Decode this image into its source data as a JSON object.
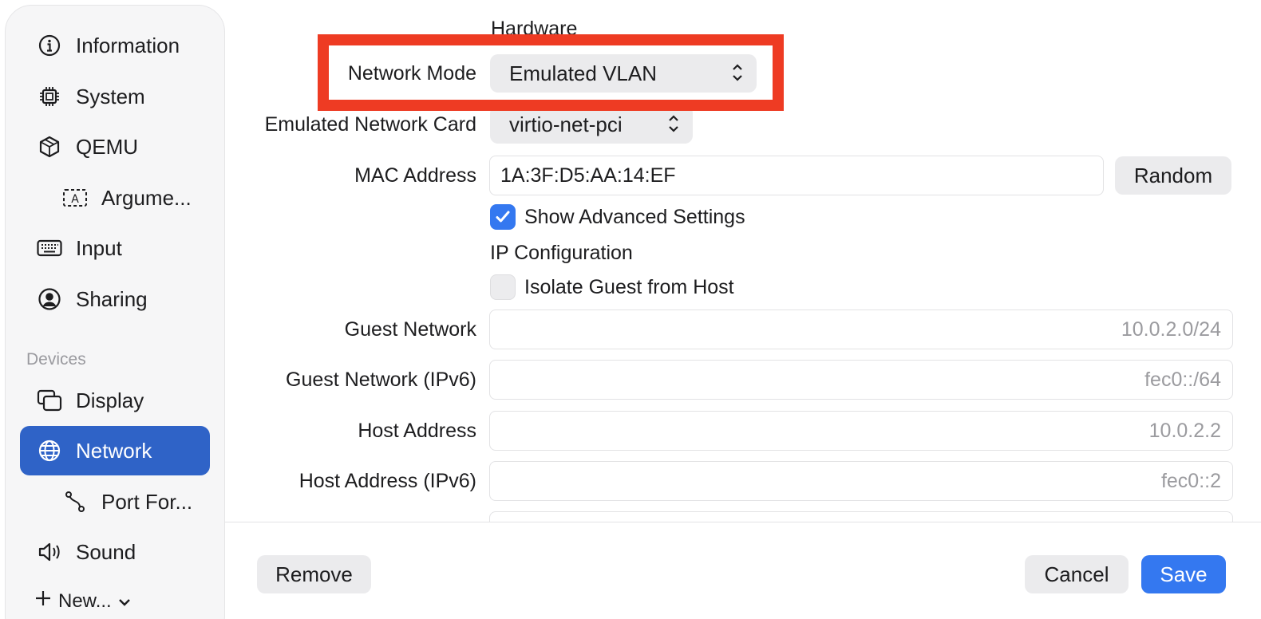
{
  "sidebar": {
    "items": [
      {
        "label": "Information",
        "icon": "info-circle-icon"
      },
      {
        "label": "System",
        "icon": "cpu-chip-icon"
      },
      {
        "label": "QEMU",
        "icon": "cube-icon"
      },
      {
        "label": "Argume...",
        "icon": "text-box-icon"
      },
      {
        "label": "Input",
        "icon": "keyboard-icon"
      },
      {
        "label": "Sharing",
        "icon": "person-circle-icon"
      },
      {
        "label": "Display",
        "icon": "display-windows-icon"
      },
      {
        "label": "Network",
        "icon": "globe-icon"
      },
      {
        "label": "Port For...",
        "icon": "route-icon"
      },
      {
        "label": "Sound",
        "icon": "speaker-icon"
      }
    ],
    "devices_header": "Devices",
    "new_label": "New...",
    "selected_item": "Network",
    "selected_color": "#2f63c7"
  },
  "form": {
    "hardware_title": "Hardware",
    "network_mode": {
      "label": "Network Mode",
      "value": "Emulated VLAN"
    },
    "network_card": {
      "label": "Emulated Network Card",
      "value": "virtio-net-pci"
    },
    "mac_address": {
      "label": "MAC Address",
      "value": "1A:3F:D5:AA:14:EF",
      "random_button": "Random"
    },
    "show_advanced": {
      "label": "Show Advanced Settings",
      "checked": true
    },
    "ip_config_title": "IP Configuration",
    "isolate_guest": {
      "label": "Isolate Guest from Host",
      "checked": false
    },
    "guest_network": {
      "label": "Guest Network",
      "placeholder": "10.0.2.0/24"
    },
    "guest_network_v6": {
      "label": "Guest Network (IPv6)",
      "placeholder": "fec0::/64"
    },
    "host_address": {
      "label": "Host Address",
      "placeholder": "10.0.2.2"
    },
    "host_address_v6": {
      "label": "Host Address (IPv6)",
      "placeholder": "fec0::2"
    }
  },
  "footer": {
    "remove_label": "Remove",
    "cancel_label": "Cancel",
    "save_label": "Save"
  },
  "colors": {
    "accent": "#3478f0",
    "highlight_box": "#ee3b23"
  }
}
